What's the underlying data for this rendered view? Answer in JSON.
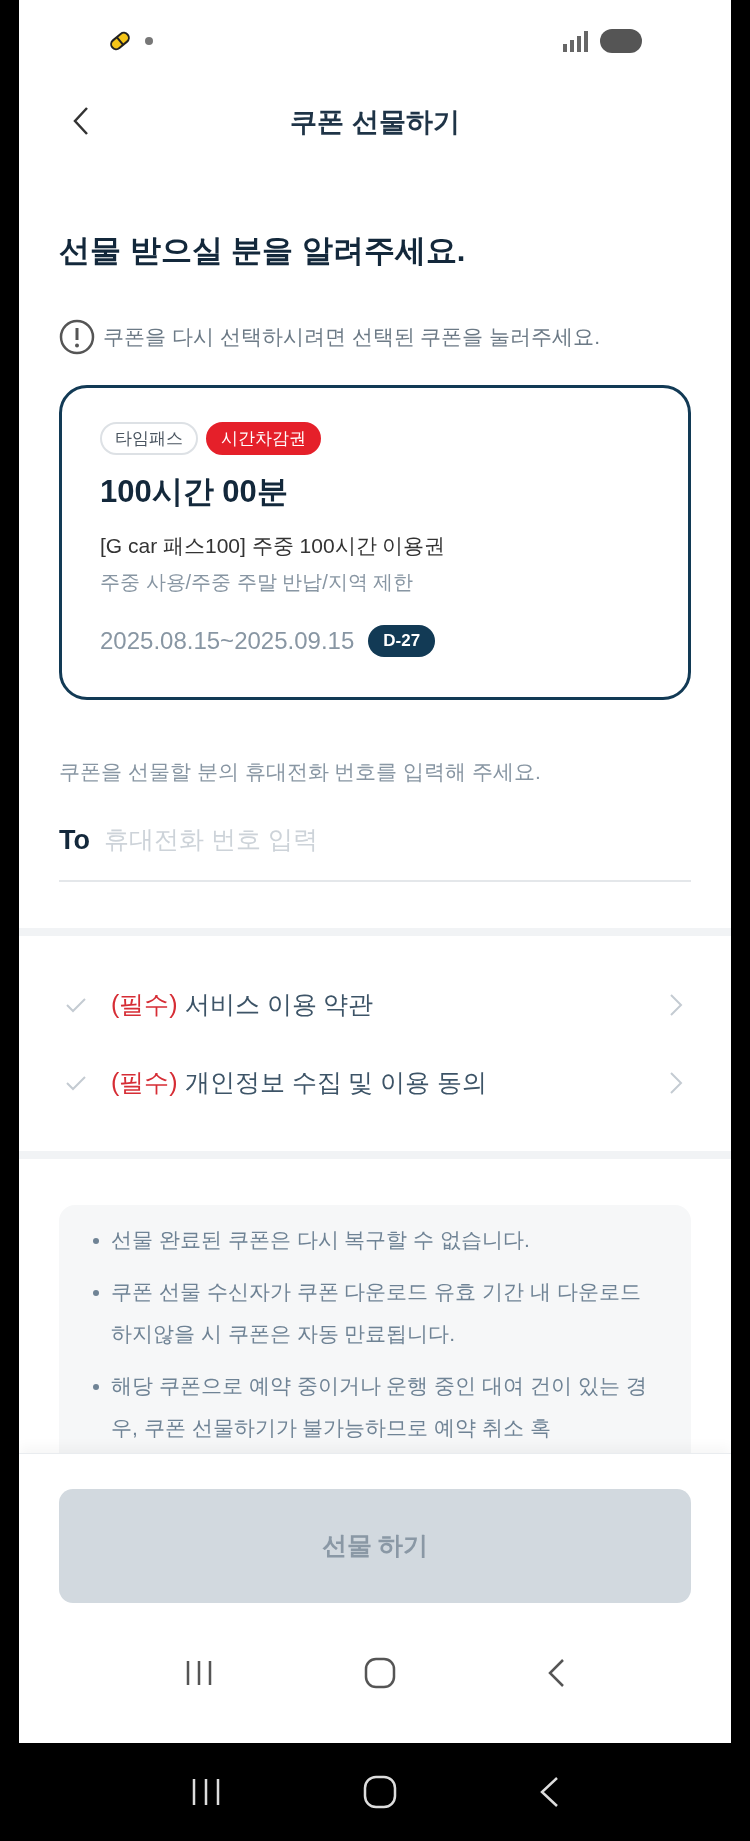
{
  "header": {
    "title": "쿠폰 선물하기"
  },
  "heading": "선물 받으실 분을 알려주세요.",
  "notice": "쿠폰을 다시 선택하시려면 선택된 쿠폰을 눌러주세요.",
  "coupon": {
    "tags": [
      {
        "label": "타임패스",
        "kind": "outline"
      },
      {
        "label": "시간차감권",
        "kind": "filled"
      }
    ],
    "title": "100시간 00분",
    "name": "[G car 패스100] 주중 100시간 이용권",
    "conditions": "주중 사용/주중 주말 반납/지역 제한",
    "period": "2025.08.15~2025.09.15",
    "dday": "D-27"
  },
  "recipient": {
    "prompt": "쿠폰을 선물할 분의 휴대전화 번호를 입력해 주세요.",
    "label": "To",
    "placeholder": "휴대전화 번호 입력"
  },
  "agreements": [
    {
      "tag": "(필수)",
      "label": "서비스 이용 약관",
      "checked": false
    },
    {
      "tag": "(필수)",
      "label": "개인정보 수집 및 이용 동의",
      "checked": false
    }
  ],
  "notes": [
    "선물 완료된 쿠폰은 다시 복구할 수 없습니다.",
    "쿠폰 선물 수신자가 쿠폰 다운로드 유효 기간 내 다운로드 하지않을 시 쿠폰은 자동 만료됩니다.",
    "해당 쿠폰으로 예약 중이거나 운행 중인 대여 건이 있는 경우, 쿠폰 선물하기가 불가능하므로 예약 취소 혹"
  ],
  "submit": {
    "label": "선물 하기",
    "disabled": true
  }
}
